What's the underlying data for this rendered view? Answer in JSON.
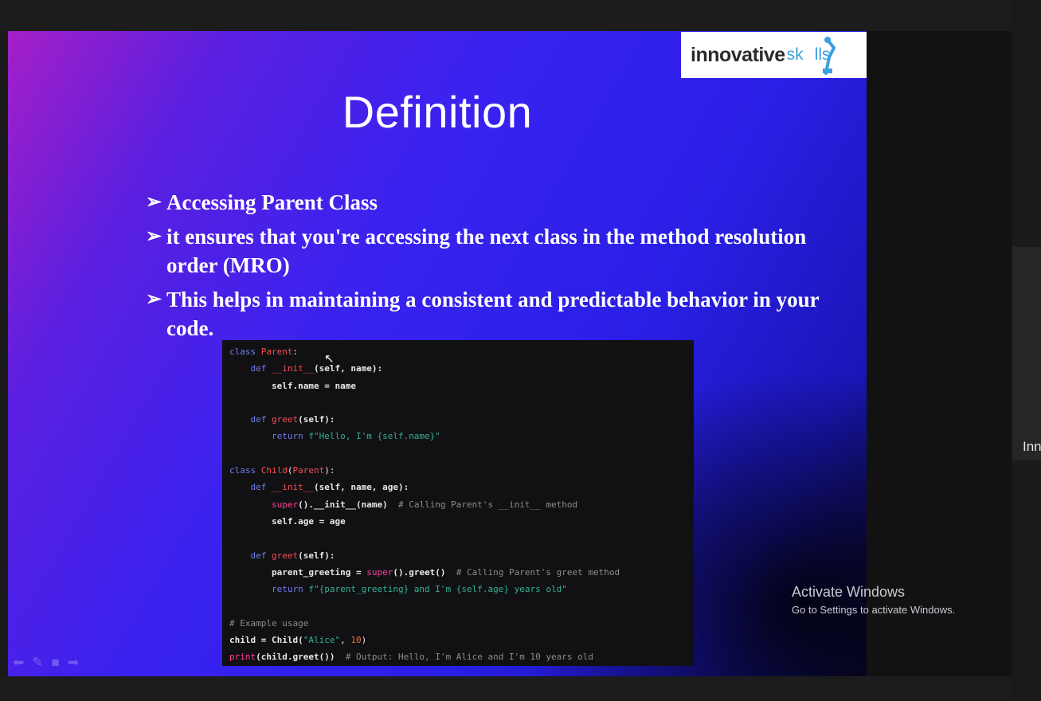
{
  "slide": {
    "logo": {
      "word1": "innovative",
      "word2": "sk",
      "word3": "lls"
    },
    "title": "Definition",
    "bullets": [
      {
        "text": "Accessing Parent Class"
      },
      {
        "text": " it ensures that you're accessing the next class in the method resolution order (MRO)"
      },
      {
        "text": "This helps in maintaining a consistent and predictable behavior in your code."
      }
    ],
    "bullet_icon": "arrow-bullet-icon"
  },
  "code": {
    "tokens": {
      "class": "class",
      "def": "def",
      "return": "return",
      "parent": "Parent",
      "child": "Child",
      "init": "__init__",
      "greet": "greet",
      "super": "super",
      "print": "print",
      "init_args": "(self, name):",
      "self_name": "self.name = name",
      "greet_args": "(self):",
      "greet_str": "f\"Hello, I'm {self.name}\"",
      "child_init_args": "(self, name, age):",
      "super_call": "().__init__(name)",
      "comment1": "# Calling Parent's __init__ method",
      "self_age": "self.age = age",
      "parent_greeting": "parent_greeting = ",
      "super_greet": "().greet()",
      "comment2": "# Calling Parent's greet method",
      "child_str": "f\"{parent_greeting} and I'm {self.age} years old\"",
      "comment3": "# Example usage",
      "child_assign": "child = Child(",
      "alice": "\"Alice\"",
      "ten": "10",
      "print_arg": "(child.greet())",
      "comment4": "# Output: Hello, I'm Alice and I'm 10 years old"
    }
  },
  "watermark": {
    "line1": "Activate Windows",
    "line2": "Go to Settings to activate Windows."
  },
  "side_panel": {
    "label": "Inn"
  },
  "colors": {
    "keyword": "#6f7ee8",
    "function": "#ff4b4b",
    "string": "#34b19a",
    "comment": "#8c8c8c"
  }
}
